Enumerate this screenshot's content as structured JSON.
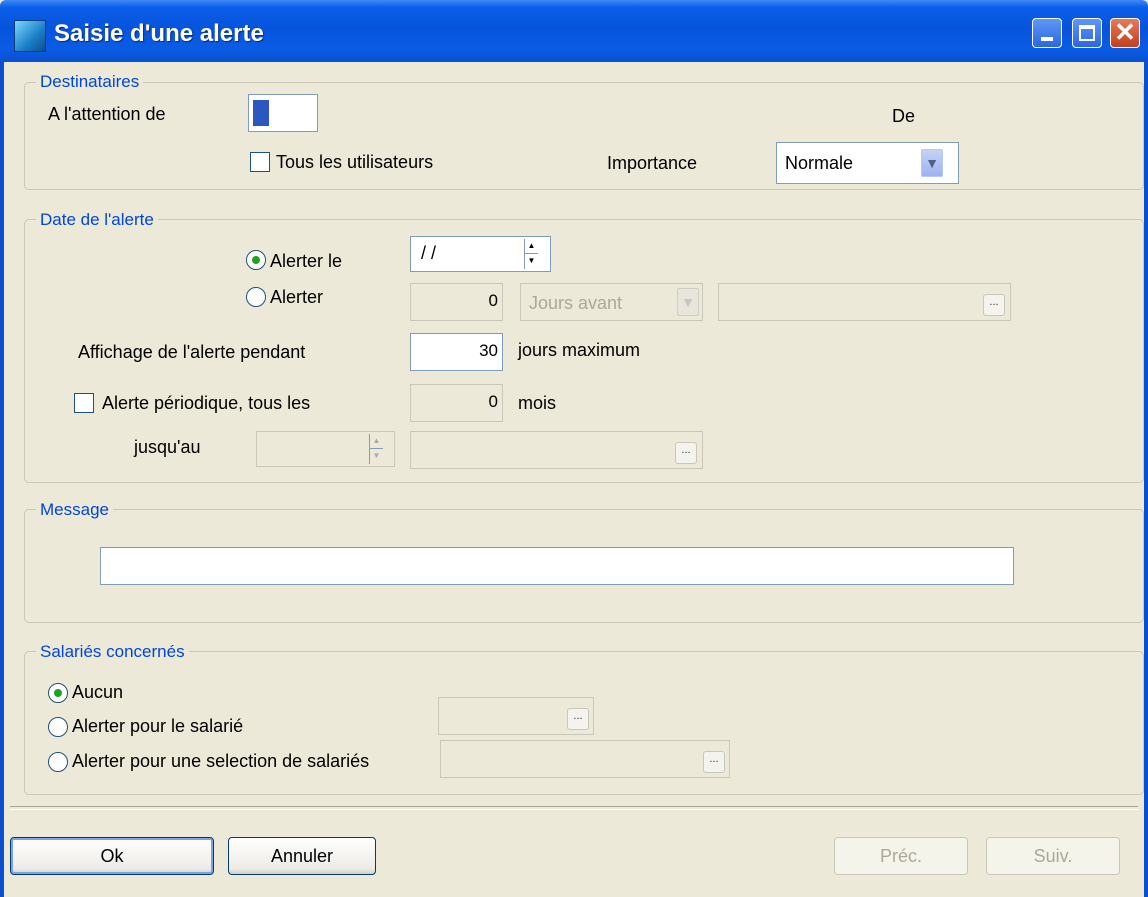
{
  "window": {
    "title": "Saisie d'une alerte"
  },
  "destinataires": {
    "legend": "Destinataires",
    "attention_label": "A l'attention de",
    "de_label": "De",
    "tous_label": "Tous les utilisateurs",
    "importance_label": "Importance",
    "importance_value": "Normale"
  },
  "date": {
    "legend": "Date de l'alerte",
    "alerter_le_label": "Alerter le",
    "date_value": "/ /",
    "alerter_label": "Alerter",
    "jours_value": "0",
    "jours_mode": "Jours avant",
    "affichage_label": "Affichage de l'alerte pendant",
    "affichage_value": "30",
    "jours_max_label": "jours maximum",
    "periodique_label": "Alerte périodique, tous les",
    "periode_value": "0",
    "mois_label": "mois",
    "jusquau_label": "jusqu'au"
  },
  "message": {
    "legend": "Message",
    "value": ""
  },
  "salaries": {
    "legend": "Salariés concernés",
    "aucun_label": "Aucun",
    "salarie_label": "Alerter pour le salarié",
    "selection_label": "Alerter pour une selection de salariés"
  },
  "buttons": {
    "ok": "Ok",
    "annuler": "Annuler",
    "prec": "Préc.",
    "suiv": "Suiv."
  },
  "colors": {
    "accent": "#0046d5",
    "titlebar": "#0754dc",
    "background": "#ece9d8",
    "radio_selected": "#21a121"
  }
}
